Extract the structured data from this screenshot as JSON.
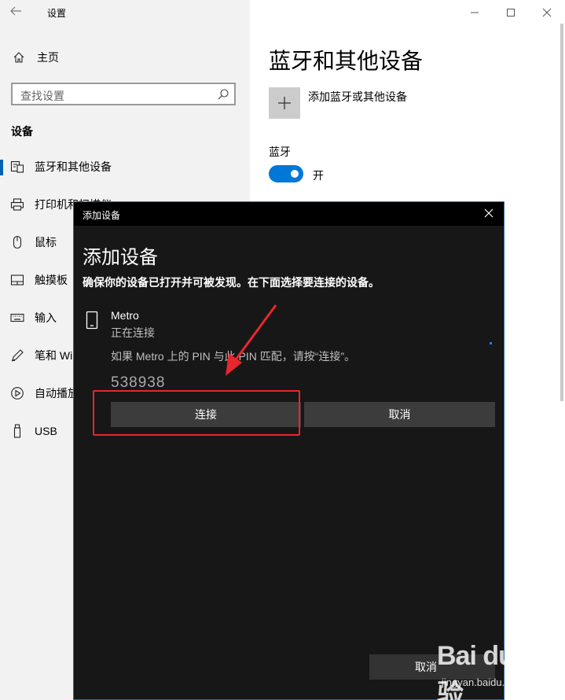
{
  "window": {
    "title": "设置",
    "back_icon": "back-arrow-icon",
    "controls": [
      "minimize-icon",
      "maximize-icon",
      "close-icon"
    ]
  },
  "sidebar": {
    "home_label": "主页",
    "search_placeholder": "查找设置",
    "section": "设备",
    "items": [
      {
        "label": "蓝牙和其他设备",
        "icon": "bluetooth-devices-icon",
        "active": true
      },
      {
        "label": "打印机和扫描仪",
        "icon": "printer-icon"
      },
      {
        "label": "鼠标",
        "icon": "mouse-icon"
      },
      {
        "label": "触摸板",
        "icon": "touchpad-icon"
      },
      {
        "label": "输入",
        "icon": "keyboard-icon"
      },
      {
        "label": "笔和 Windows Ink",
        "icon": "pen-icon"
      },
      {
        "label": "自动播放",
        "icon": "autoplay-icon"
      },
      {
        "label": "USB",
        "icon": "usb-icon"
      }
    ]
  },
  "main": {
    "title": "蓝牙和其他设备",
    "add_device_label": "添加蓝牙或其他设备",
    "bluetooth_header": "蓝牙",
    "bluetooth_toggle": {
      "state": "开",
      "on": true
    }
  },
  "dialog": {
    "titlebar": "添加设备",
    "heading": "添加设备",
    "description": "确保你的设备已打开并可被发现。在下面选择要连接的设备。",
    "device": {
      "name": "Metro",
      "status": "正在连接",
      "pin_message": "如果 Metro 上的 PIN 与此 PIN 匹配，请按“连接”。",
      "pin": "538938"
    },
    "connect_button": "连接",
    "cancel_button": "取消",
    "bottom_cancel_button": "取消"
  },
  "annotation": {
    "color": "#e8262d"
  },
  "watermark": {
    "logo": "Bai du 经验",
    "url": "jingyan.baidu.com"
  },
  "colors": {
    "accent": "#0078d7",
    "dialog_bg": "#171717",
    "sidebar_bg": "#f2f2f2"
  }
}
